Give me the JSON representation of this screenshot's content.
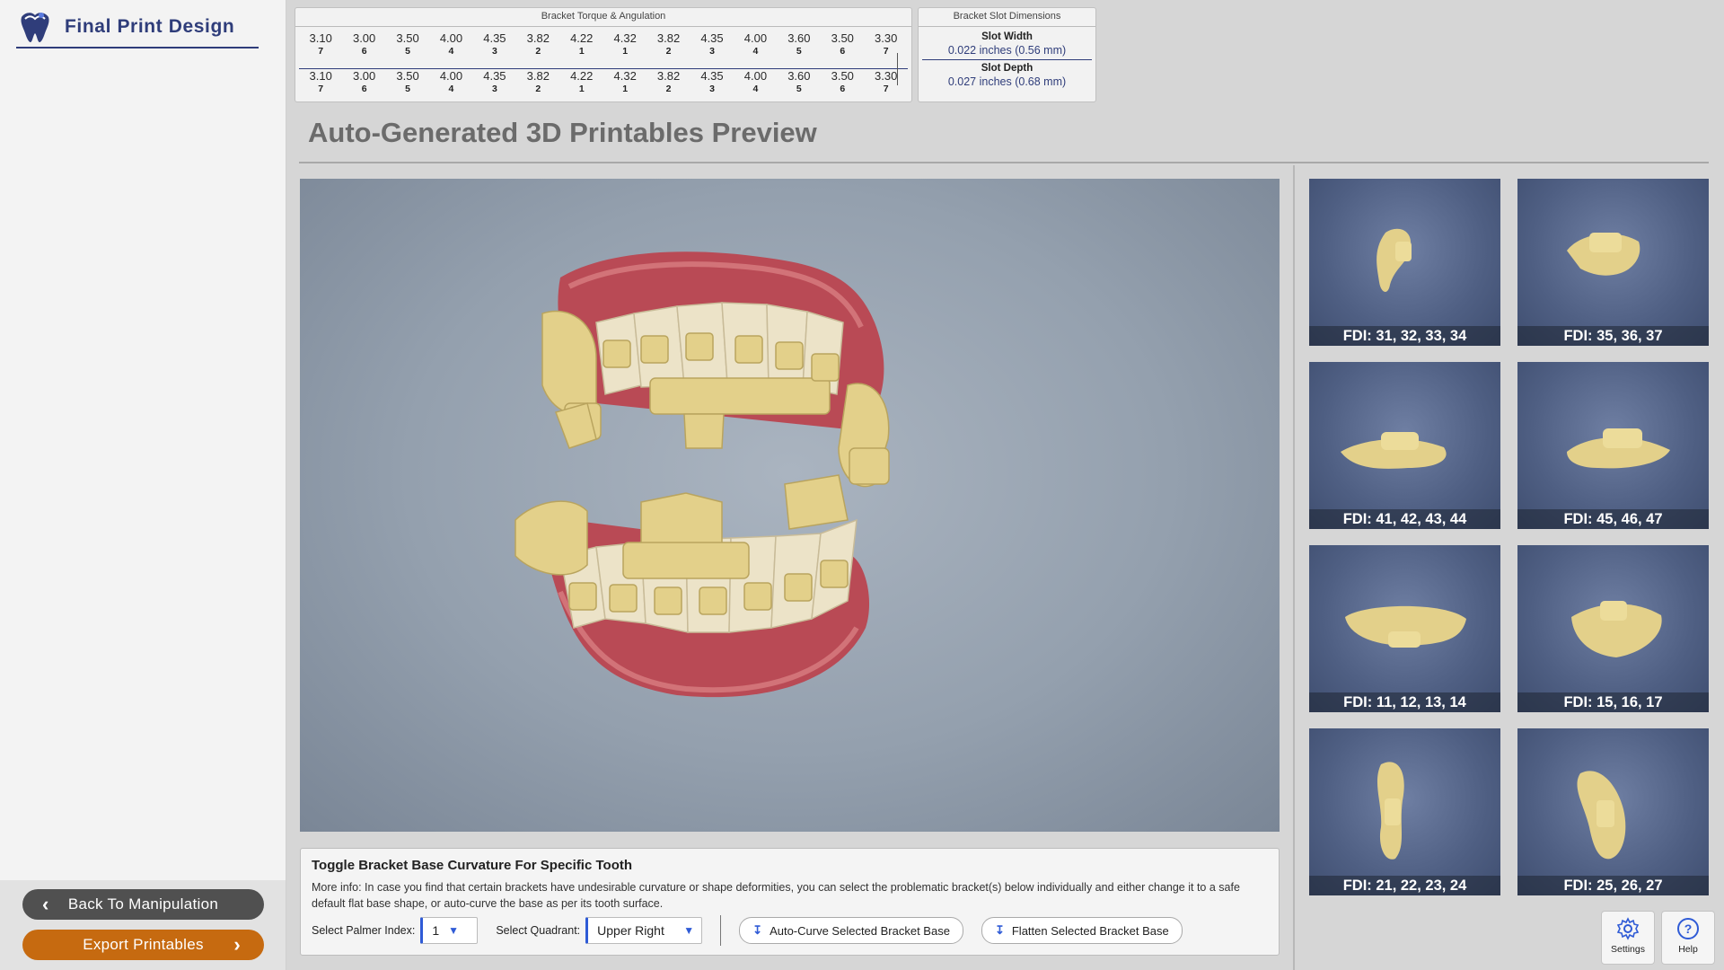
{
  "app": {
    "title": "Final Print Design"
  },
  "sidebar": {
    "back_label": "Back To Manipulation",
    "export_label": "Export Printables"
  },
  "torque_table": {
    "title": "Bracket Torque & Angulation",
    "upper_values": [
      "3.10",
      "3.00",
      "3.50",
      "4.00",
      "4.35",
      "3.82",
      "4.22",
      "4.32",
      "3.82",
      "4.35",
      "4.00",
      "3.60",
      "3.50",
      "3.30"
    ],
    "upper_numbers": [
      "7",
      "6",
      "5",
      "4",
      "3",
      "2",
      "1",
      "1",
      "2",
      "3",
      "4",
      "5",
      "6",
      "7"
    ],
    "lower_values": [
      "3.10",
      "3.00",
      "3.50",
      "4.00",
      "4.35",
      "3.82",
      "4.22",
      "4.32",
      "3.82",
      "4.35",
      "4.00",
      "3.60",
      "3.50",
      "3.30"
    ],
    "lower_numbers": [
      "7",
      "6",
      "5",
      "4",
      "3",
      "2",
      "1",
      "1",
      "2",
      "3",
      "4",
      "5",
      "6",
      "7"
    ]
  },
  "slot_dimensions": {
    "title": "Bracket Slot Dimensions",
    "width_label": "Slot Width",
    "width_value": "0.022 inches (0.56 mm)",
    "depth_label": "Slot Depth",
    "depth_value": "0.027 inches (0.68 mm)"
  },
  "main": {
    "heading": "Auto-Generated 3D Printables Preview"
  },
  "thumbnails": [
    {
      "label": "FDI: 31, 32, 33, 34"
    },
    {
      "label": "FDI: 35, 36, 37"
    },
    {
      "label": "FDI: 41, 42, 43, 44"
    },
    {
      "label": "FDI: 45, 46, 47"
    },
    {
      "label": "FDI: 11, 12, 13, 14"
    },
    {
      "label": "FDI: 15, 16, 17"
    },
    {
      "label": "FDI: 21, 22, 23, 24"
    },
    {
      "label": "FDI: 25, 26, 27"
    }
  ],
  "controls": {
    "title": "Toggle Bracket Base Curvature For Specific Tooth",
    "info": "More info: In case you find that certain brackets have undesirable curvature or shape deformities, you can select the problematic bracket(s) below individually and either change it to a safe default flat base shape, or auto-curve the base as per its tooth surface.",
    "palmer_label": "Select Palmer Index:",
    "palmer_value": "1",
    "quadrant_label": "Select Quadrant:",
    "quadrant_value": "Upper Right",
    "auto_curve_label": "Auto-Curve Selected Bracket Base",
    "flatten_label": "Flatten Selected Bracket Base"
  },
  "footer": {
    "settings_label": "Settings",
    "help_label": "Help"
  },
  "colors": {
    "accent": "#2f3d7a",
    "export": "#c66a10",
    "back": "#505050",
    "resin": "#e3d08a",
    "gum": "#c4545c"
  }
}
